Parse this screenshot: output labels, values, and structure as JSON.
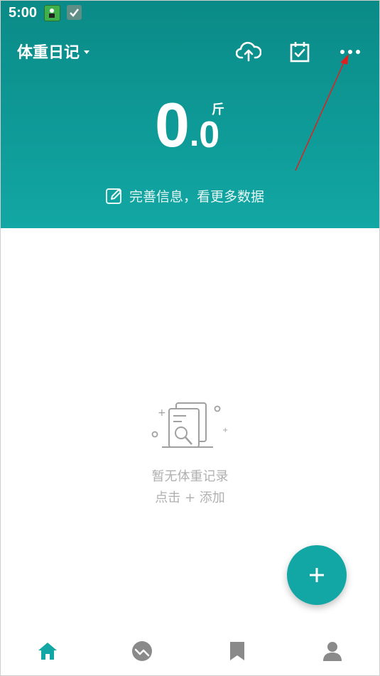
{
  "status_bar": {
    "time": "5:00"
  },
  "header": {
    "title": "体重日记",
    "toolbar": {
      "cloud_icon": "cloud-upload-icon",
      "calendar_icon": "calendar-check-icon",
      "more_icon": "more-dots-icon"
    }
  },
  "weight": {
    "integer": "0",
    "dot": ".",
    "decimal": "0",
    "unit": "斤"
  },
  "complete_info": {
    "text": "完善信息，看更多数据",
    "icon": "edit-icon"
  },
  "empty_state": {
    "title": "暂无体重记录",
    "subtitle": "点击 + 添加"
  },
  "fab": {
    "label": "+"
  },
  "bottom_nav": [
    {
      "icon": "home-icon",
      "active": true
    },
    {
      "icon": "trend-icon",
      "active": false
    },
    {
      "icon": "bookmark-icon",
      "active": false
    },
    {
      "icon": "profile-icon",
      "active": false
    }
  ],
  "colors": {
    "primary": "#12a7a4",
    "primary_dark": "#0a8a87",
    "nav_active": "#12a7a4",
    "nav_inactive": "#8a8a8a",
    "annotation_arrow": "#e02020"
  }
}
